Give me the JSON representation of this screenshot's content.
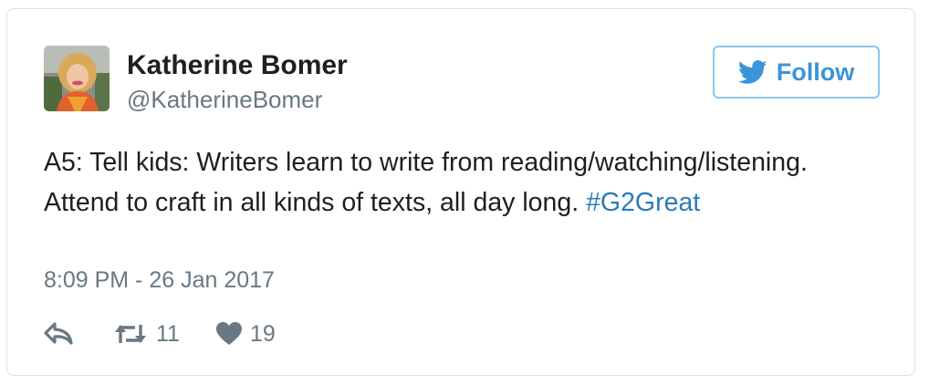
{
  "author": {
    "name": "Katherine Bomer",
    "handle": "@KatherineBomer"
  },
  "follow_button": {
    "label": "Follow",
    "icon": "twitter-bird-icon"
  },
  "tweet": {
    "text_before_hashtag": "A5: Tell kids: Writers learn to write from reading/watching/listening. Attend to craft in all kinds of texts, all day long. ",
    "hashtag": "#G2Great",
    "timestamp": "8:09 PM - 26 Jan 2017"
  },
  "actions": {
    "reply_icon": "reply-icon",
    "retweet_icon": "retweet-icon",
    "retweet_count": "11",
    "like_icon": "heart-icon",
    "like_count": "19"
  },
  "colors": {
    "accent": "#3b94d9",
    "hashtag": "#2b7bb9",
    "secondary_text": "#697882",
    "border": "#dcdfe2"
  }
}
